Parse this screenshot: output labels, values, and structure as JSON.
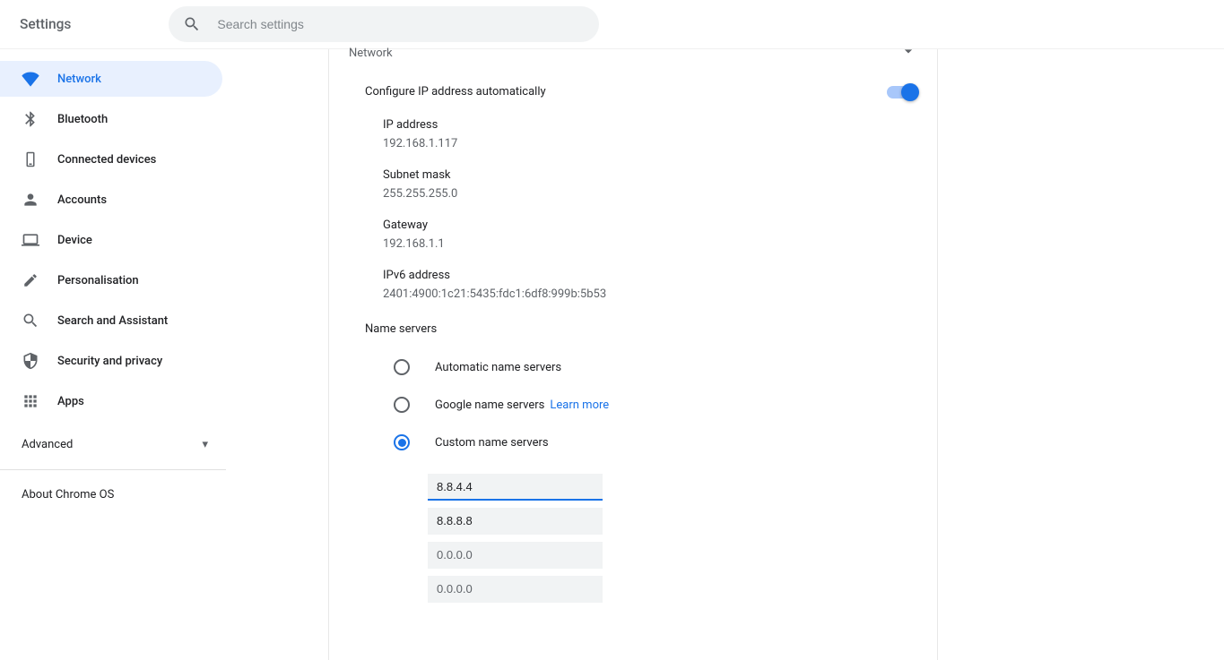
{
  "header": {
    "title": "Settings",
    "search_placeholder": "Search settings"
  },
  "sidebar": {
    "items": [
      {
        "label": "Network",
        "active": true
      },
      {
        "label": "Bluetooth"
      },
      {
        "label": "Connected devices"
      },
      {
        "label": "Accounts"
      },
      {
        "label": "Device"
      },
      {
        "label": "Personalisation"
      },
      {
        "label": "Search and Assistant"
      },
      {
        "label": "Security and privacy"
      },
      {
        "label": "Apps"
      }
    ],
    "advanced_label": "Advanced",
    "about_label": "About Chrome OS"
  },
  "panel": {
    "network_header": "Network",
    "toggle_label": "Configure IP address automatically",
    "toggle_on": true,
    "info": {
      "ip_label": "IP address",
      "ip_value": "192.168.1.117",
      "subnet_label": "Subnet mask",
      "subnet_value": "255.255.255.0",
      "gateway_label": "Gateway",
      "gateway_value": "192.168.1.1",
      "ipv6_label": "IPv6 address",
      "ipv6_value": "2401:4900:1c21:5435:fdc1:6df8:999b:5b53"
    },
    "ns_title": "Name servers",
    "ns_auto": "Automatic name servers",
    "ns_google": "Google name servers",
    "learn_more": "Learn more",
    "ns_custom": "Custom name servers",
    "dns": [
      "8.8.4.4",
      "8.8.8.8",
      "0.0.0.0",
      "0.0.0.0"
    ]
  }
}
